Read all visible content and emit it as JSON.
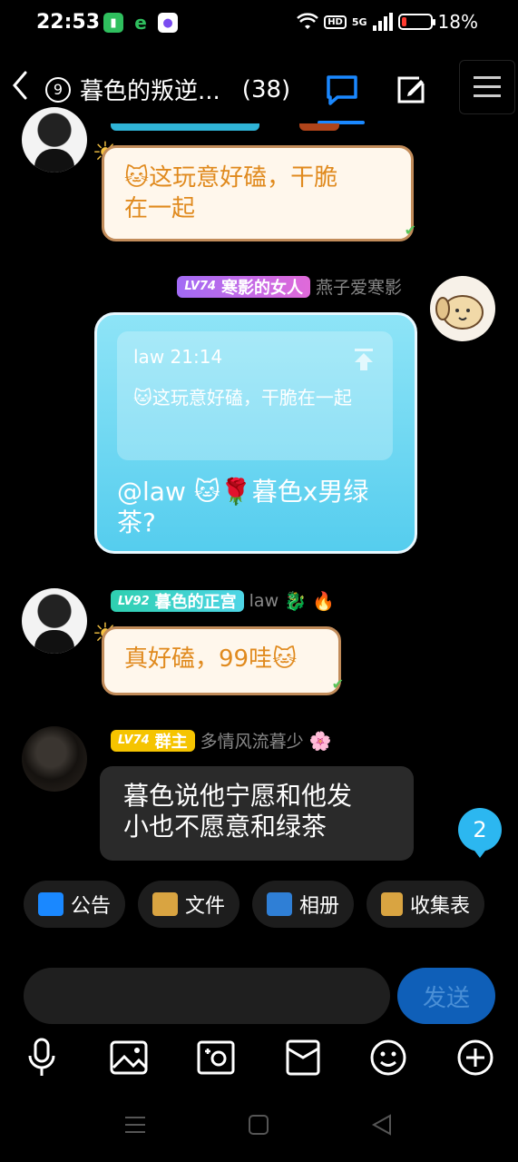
{
  "status": {
    "time": "22:53",
    "battery": "18%",
    "battery_level": 0.18,
    "network": "5G",
    "hd": "HD"
  },
  "header": {
    "group_number": "9",
    "title": "暮色的叛逆...",
    "member_count": "(38)"
  },
  "messages": [
    {
      "text_line1": "🐱这玩意好磕，干脆",
      "text_line2": "在一起"
    },
    {
      "level": "LV74",
      "title_badge": "寒影的女人",
      "nickname": "燕子爱寒影",
      "quote_header": "law 21:14",
      "quote_text": "🐱这玩意好磕，干脆在一起",
      "text": "@law 🐱🌹暮色x男绿茶?"
    },
    {
      "level": "LV92",
      "title_badge": "暮色的正宫",
      "nickname": "law",
      "text": "真好磕，99哇🐱"
    },
    {
      "level": "LV74",
      "title_badge": "群主",
      "nickname": "多情风流暮少",
      "text_line1": "暮色说他宁愿和他发",
      "text_line2": "小也不愿意和绿茶"
    }
  ],
  "unread_count": "2",
  "quick_actions": [
    {
      "label": "公告",
      "icon": "announcement-icon",
      "color": "#1a88ff"
    },
    {
      "label": "文件",
      "icon": "folder-icon",
      "color": "#d9a441"
    },
    {
      "label": "相册",
      "icon": "photo-album-icon",
      "color": "#2f7fd6"
    },
    {
      "label": "收集表",
      "icon": "clipboard-icon",
      "color": "#d9a441"
    }
  ],
  "input": {
    "placeholder": "",
    "send_label": "发送"
  }
}
